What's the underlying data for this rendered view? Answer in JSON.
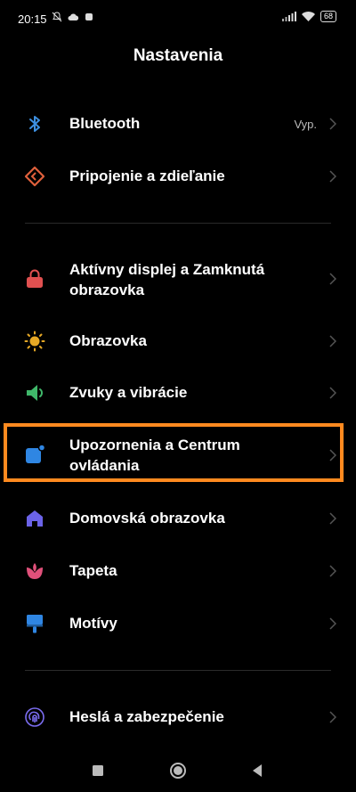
{
  "status_bar": {
    "time": "20:15",
    "left_icons": [
      "mute-icon",
      "cloud-icon",
      "square-icon"
    ],
    "right_icons": [
      "signal-icon",
      "wifi-icon"
    ],
    "battery": "68"
  },
  "header": {
    "title": "Nastavenia"
  },
  "settings": [
    {
      "id": "bluetooth",
      "label": "Bluetooth",
      "value": "Vyp.",
      "icon": "bluetooth-icon",
      "color": "#3d8fe0"
    },
    {
      "id": "connection",
      "label": "Pripojenie a zdieľanie",
      "icon": "connection-icon",
      "color": "#e0603c"
    },
    {
      "id": "lock",
      "label_line1": "Aktívny displej a Zamknutá",
      "label_line2": "obrazovka",
      "icon": "lock-icon",
      "color": "#e05050"
    },
    {
      "id": "display",
      "label": "Obrazovka",
      "icon": "sun-icon",
      "color": "#e6a825"
    },
    {
      "id": "sound",
      "label": "Zvuky a vibrácie",
      "icon": "speaker-icon",
      "color": "#3fb86a"
    },
    {
      "id": "notifications",
      "label_line1": "Upozornenia a Centrum",
      "label_line2": "ovládania",
      "icon": "notification-icon",
      "color": "#2f86e3"
    },
    {
      "id": "home",
      "label": "Domovská obrazovka",
      "icon": "home-icon",
      "color": "#6b63e8"
    },
    {
      "id": "wallpaper",
      "label": "Tapeta",
      "icon": "flower-icon",
      "color": "#e0507a"
    },
    {
      "id": "themes",
      "label": "Motívy",
      "icon": "brush-icon",
      "color": "#2f86e3"
    },
    {
      "id": "security",
      "label": "Heslá a zabezpečenie",
      "icon": "fingerprint-icon",
      "color": "#7b6df0"
    }
  ],
  "nav_bar": {
    "buttons": [
      "recents-button",
      "home-button",
      "back-button"
    ]
  }
}
